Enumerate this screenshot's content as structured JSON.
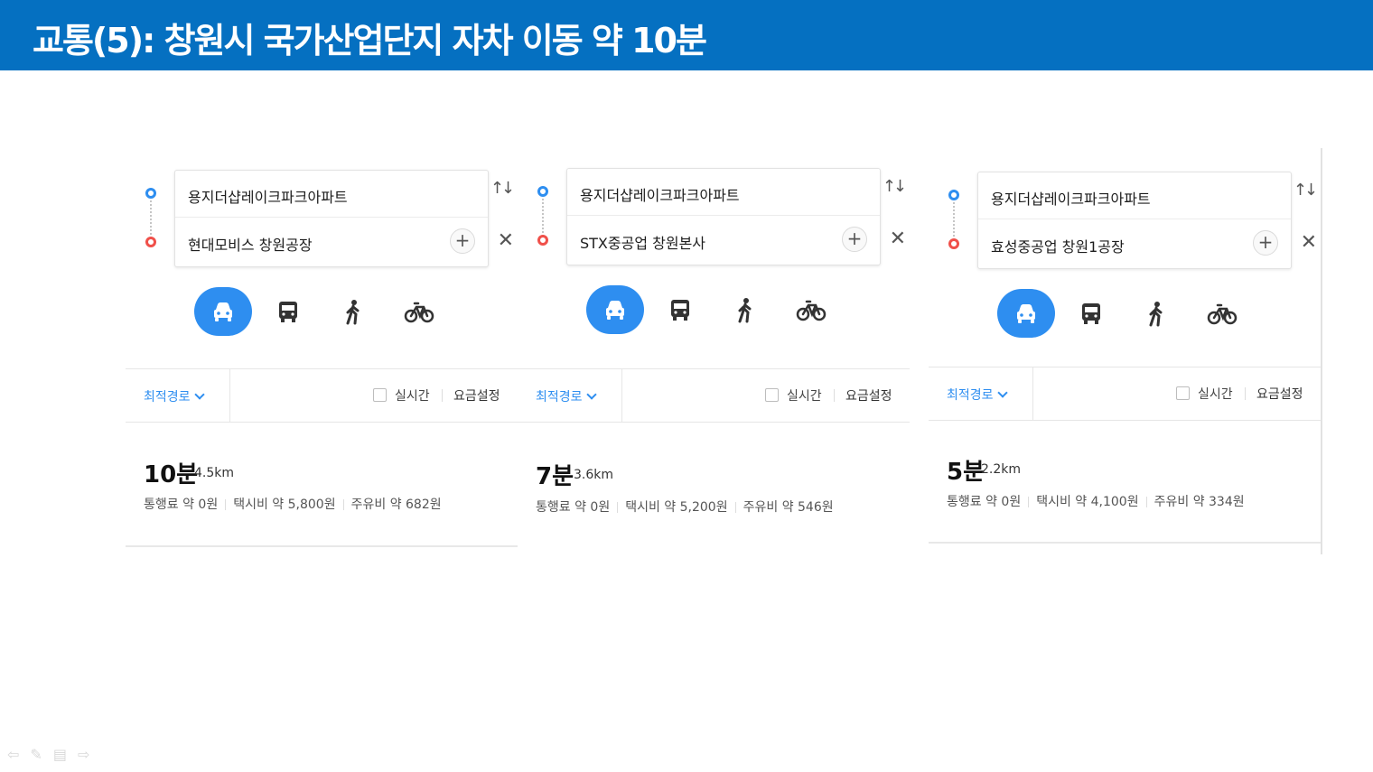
{
  "slide_title": "교통(5): 창원시 국가산업단지 자차 이동 약 10분",
  "panels": [
    {
      "origin": "용지더샵레이크파크아파트",
      "destination": "현대모비스 창원공장",
      "route_option": "최적경로",
      "realtime_label": "실시간",
      "fare_setting_label": "요금설정",
      "time": "10분",
      "distance": "4.5km",
      "toll": "통행료 약 0원",
      "taxi": "택시비 약 5,800원",
      "fuel": "주유비 약 682원"
    },
    {
      "origin": "용지더샵레이크파크아파트",
      "destination": "STX중공업 창원본사",
      "route_option": "최적경로",
      "realtime_label": "실시간",
      "fare_setting_label": "요금설정",
      "time": "7분",
      "distance": "3.6km",
      "toll": "통행료 약 0원",
      "taxi": "택시비 약 5,200원",
      "fuel": "주유비 약 546원"
    },
    {
      "origin": "용지더샵레이크파크아파트",
      "destination": "효성중공업 창원1공장",
      "route_option": "최적경로",
      "realtime_label": "실시간",
      "fare_setting_label": "요금설정",
      "time": "5분",
      "distance": "2.2km",
      "toll": "통행료 약 0원",
      "taxi": "택시비 약 4,100원",
      "fuel": "주유비 약 334원"
    }
  ],
  "icons": {
    "swap": "swap-icon",
    "close": "close-icon",
    "add": "plus-icon",
    "modes": [
      "car-icon",
      "bus-icon",
      "walk-icon",
      "bicycle-icon"
    ]
  },
  "colors": {
    "banner": "#0570c1",
    "accent": "#2e8ef0",
    "origin_pin": "#2e8ef0",
    "destination_pin": "#f0504a"
  }
}
